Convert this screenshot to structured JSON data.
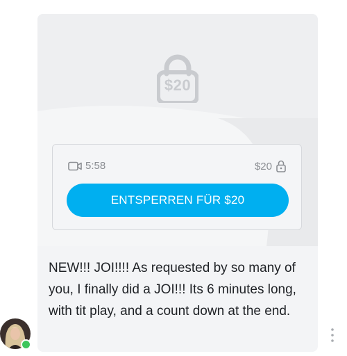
{
  "post": {
    "lock_price": "$20",
    "duration": "5:58",
    "price": "$20",
    "unlock_button_label": "ENTSPERREN FÜR $20",
    "caption": "NEW!!! JOI!!!! As requested by so many of you, I finally did a JOI!!! Its 6 minutes long, with tit play, and a count down at the end."
  },
  "author": {
    "online": true
  },
  "icons": {
    "lock": "lock-icon",
    "video": "video-camera-icon",
    "small_lock": "padlock-icon",
    "more": "more-vertical-icon"
  },
  "colors": {
    "accent": "#00aff0",
    "online": "#3ec65c",
    "muted": "#8a8d92"
  }
}
